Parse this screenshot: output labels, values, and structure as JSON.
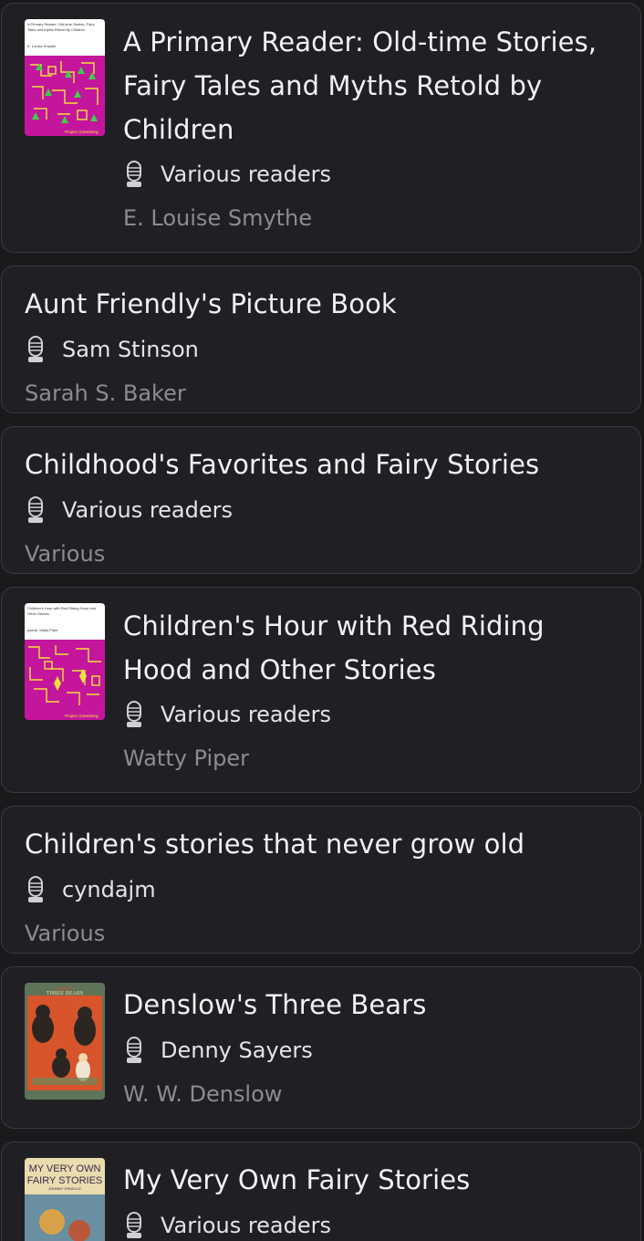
{
  "books": [
    {
      "title_lines": [
        "A Primary Reader: Old-time Stories,",
        "Fairy Tales and Myths Retold by",
        "Children"
      ],
      "reader": "Various readers",
      "author": "E. Louise Smythe",
      "cover": {
        "style": "gutenberg-magenta",
        "title_text": [
          "A Primary Reader: Old-time Stories, Fairy",
          "Tales and Myths Retold by Children"
        ],
        "author_text": "E. Louise Smythe",
        "imprint": "Project Gutenberg",
        "color": "#c4169c"
      }
    },
    {
      "title_lines": [
        "Aunt Friendly's Picture Book"
      ],
      "reader": "Sam Stinson",
      "author": "Sarah S. Baker"
    },
    {
      "title_lines": [
        "Childhood's Favorites and Fairy Stories"
      ],
      "reader": "Various readers",
      "author": "Various"
    },
    {
      "title_lines": [
        "Children's Hour with Red Riding",
        "Hood and Other Stories"
      ],
      "reader": "Various readers",
      "author": "Watty Piper",
      "cover": {
        "style": "gutenberg-magenta",
        "title_text": [
          "Children's Hour with Red Riding Hood and",
          "Other Stories"
        ],
        "author_text": "pseud. Watty Piper",
        "imprint": "Project Gutenberg",
        "color": "#c4169c"
      }
    },
    {
      "title_lines": [
        "Children's stories that never grow old"
      ],
      "reader": "cyndajm",
      "author": "Various"
    },
    {
      "title_lines": [
        "Denslow's Three Bears"
      ],
      "reader": "Denny Sayers",
      "author": "W. W. Denslow",
      "cover": {
        "style": "illustrated-bears",
        "title_text": [
          "Denslow's",
          "THREE BEARS"
        ],
        "color": "#d8552c"
      }
    },
    {
      "title_lines": [
        "My Very Own Fairy Stories"
      ],
      "reader": "Various readers",
      "author": "",
      "cover": {
        "style": "illustrated-fairy",
        "title_text": [
          "MY VERY OWN",
          "FAIRY STORIES",
          "JOHNNY GRUELLE"
        ],
        "color": "#e9dcae"
      }
    }
  ],
  "icons": {
    "reader_icon": "microphone-icon"
  },
  "colors": {
    "background": "#1a1a1d",
    "card": "#202024",
    "card_border": "#3a3a3f",
    "title_text": "#f2f2f4",
    "reader_text": "#e4e4e8",
    "author_text": "#8b8b92"
  }
}
